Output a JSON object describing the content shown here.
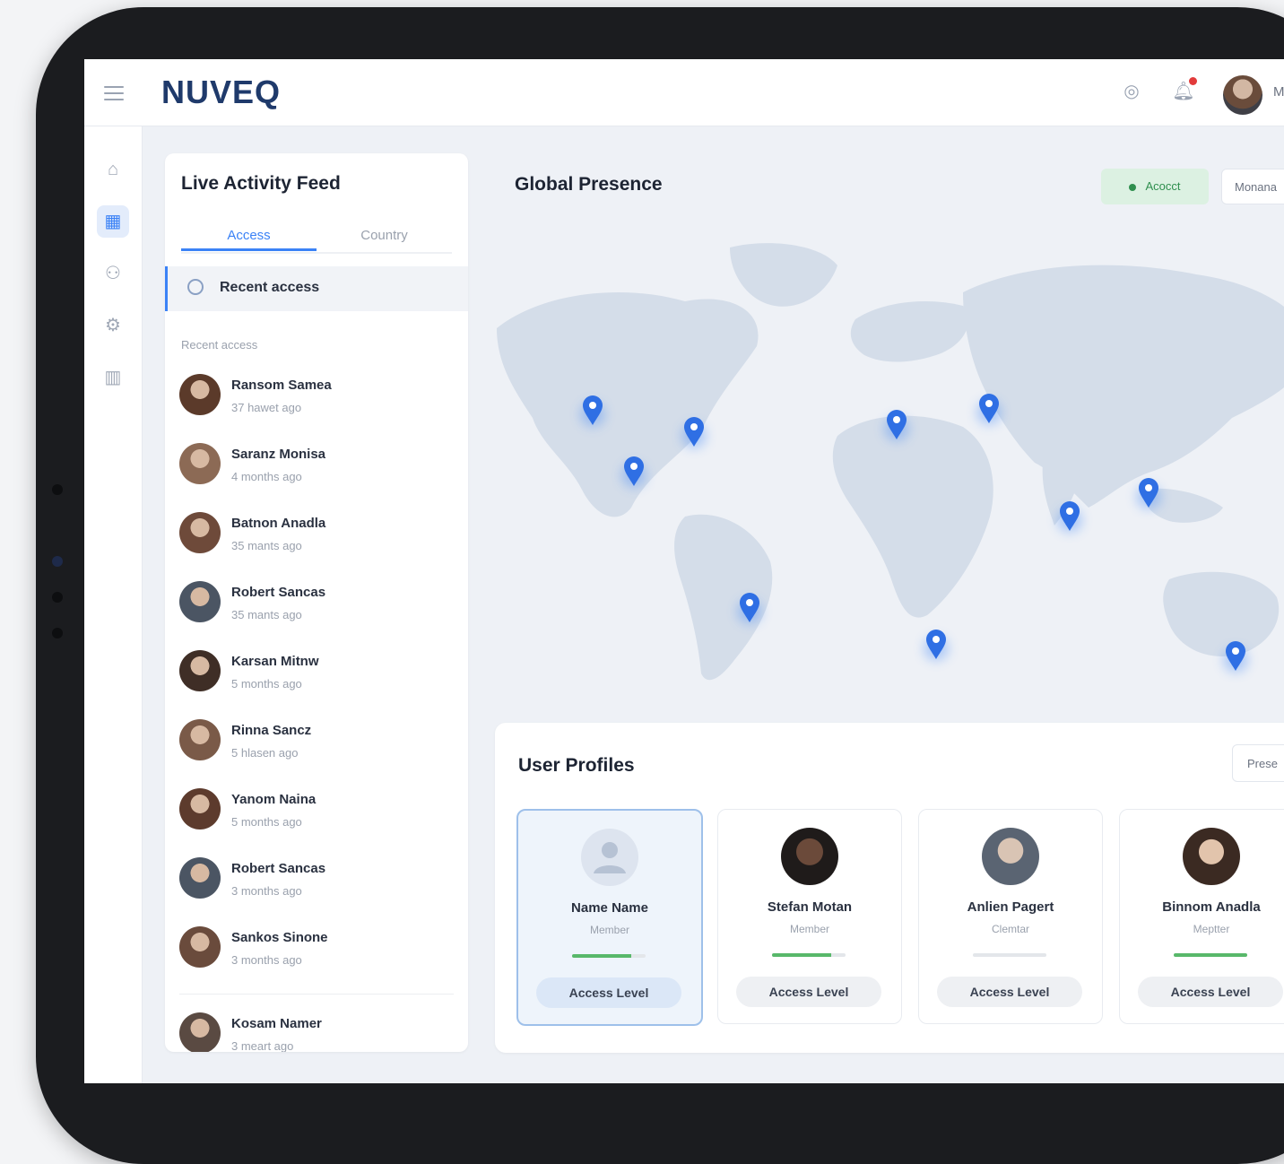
{
  "brand": {
    "logo": "NUVEQ"
  },
  "topbar": {
    "user_initial": "M"
  },
  "sidenav": {
    "items": [
      {
        "icon": "home-icon"
      },
      {
        "icon": "dashboard-icon",
        "active": true
      },
      {
        "icon": "users-icon"
      },
      {
        "icon": "settings-icon"
      },
      {
        "icon": "columns-icon"
      }
    ]
  },
  "feed": {
    "title": "Live Activity Feed",
    "tabs": [
      "Access",
      "Country"
    ],
    "active_tab": "Access",
    "highlight": "Recent access",
    "section_label": "Recent access",
    "items": [
      {
        "name": "Ransom Samea",
        "time": "37 hawet ago"
      },
      {
        "name": "Saranz Monisa",
        "time": "4 months ago"
      },
      {
        "name": "Batnon Anadla",
        "time": "35 mants ago"
      },
      {
        "name": "Robert Sancas",
        "time": "35 mants ago"
      },
      {
        "name": "Karsan Mitnw",
        "time": "5 months ago"
      },
      {
        "name": "Rinna Sancz",
        "time": "5 hlasen ago"
      },
      {
        "name": "Yanom Naina",
        "time": "5 months ago"
      },
      {
        "name": "Robert Sancas",
        "time": "3 months ago"
      },
      {
        "name": "Sankos Sinone",
        "time": "3 months ago"
      },
      {
        "name": "Kosam Namer",
        "time": "3 meart ago"
      }
    ]
  },
  "main": {
    "title": "Global Presence",
    "status_pill": "Acocct",
    "select_label": "Monana",
    "pins": 11
  },
  "profiles": {
    "title": "User Profiles",
    "button": "Prese",
    "cards": [
      {
        "name": "Name Name",
        "role": "Member",
        "level": 0.8,
        "action": "Access Level"
      },
      {
        "name": "Stefan Motan",
        "role": "Member",
        "level": 0.8,
        "action": "Access Level"
      },
      {
        "name": "Anlien Pagert",
        "role": "Clemtar",
        "level": 0.0,
        "action": "Access Level"
      },
      {
        "name": "Binnom Anadla",
        "role": "Meptter",
        "level": 1.0,
        "action": "Access Level"
      }
    ]
  },
  "colors": {
    "accent": "#3b82f6",
    "success": "#58b86a",
    "brand": "#1f3a6b"
  }
}
